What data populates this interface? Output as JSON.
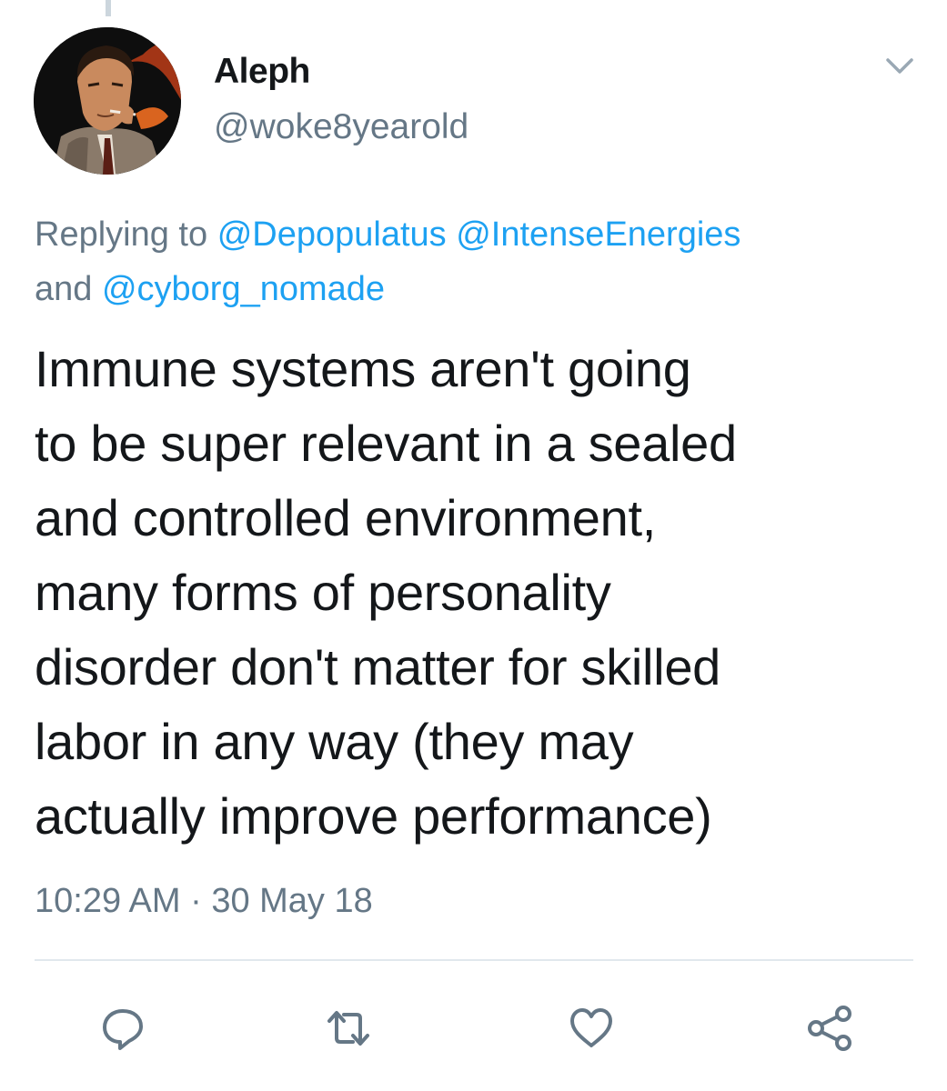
{
  "tweet": {
    "display_name": "Aleph",
    "handle": "@woke8yearold",
    "reply_context": {
      "prefix": "Replying to",
      "mentions": [
        "@Depopulatus",
        "@IntenseEnergies",
        "@cyborg_nomade"
      ],
      "conjunction": "and"
    },
    "text_lines": [
      "Immune systems aren't going",
      "to be super relevant in a sealed",
      "and controlled environment,",
      "many forms of personality",
      "disorder don't matter for skilled",
      "labor in any way (they may",
      "actually improve performance)"
    ],
    "timestamp": "10:29 AM · 30 May 18"
  },
  "icons": {
    "menu": "chevron-down-icon",
    "reply": "speech-bubble-icon",
    "retweet": "retweet-arrows-icon",
    "like": "heart-icon",
    "share": "share-nodes-icon"
  },
  "colors": {
    "text_primary": "#14171a",
    "text_secondary": "#657786",
    "link_blue": "#1da1f2",
    "divider": "#e1e8ed"
  }
}
